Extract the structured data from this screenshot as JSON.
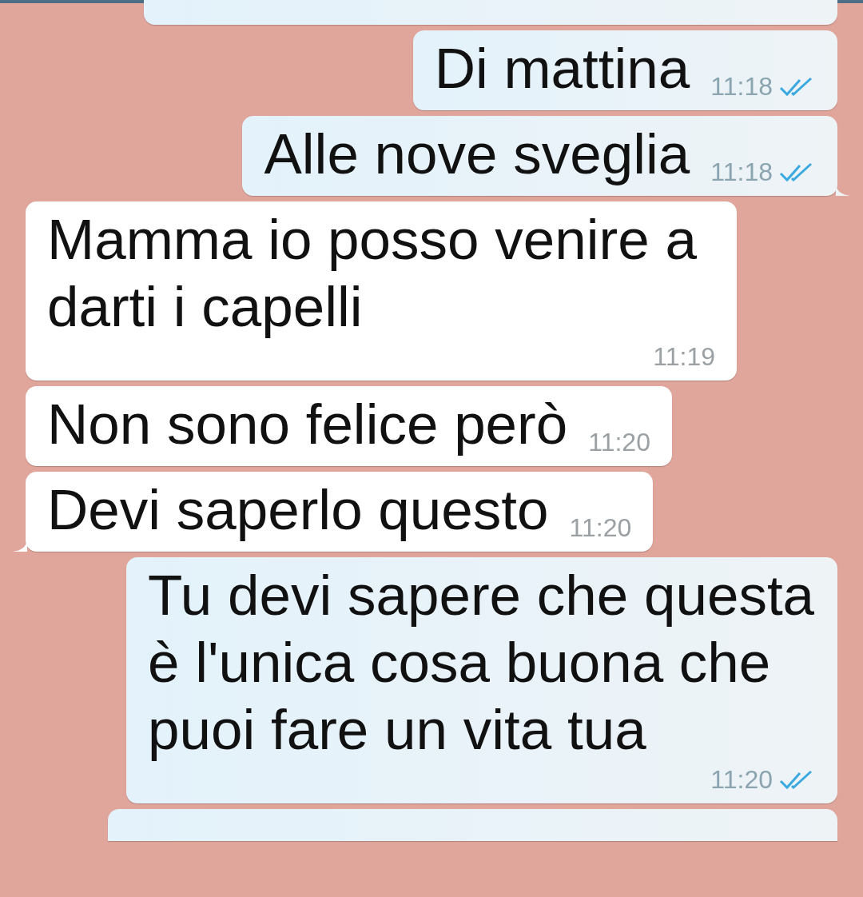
{
  "messages": [
    {
      "kind": "cropped",
      "outgoing": true
    },
    {
      "kind": "text",
      "outgoing": true,
      "text": "Di mattina",
      "time": "11:18",
      "read": true,
      "tail": false
    },
    {
      "kind": "text",
      "outgoing": true,
      "text": "Alle nove sveglia",
      "time": "11:18",
      "read": true,
      "tail": true
    },
    {
      "kind": "text",
      "outgoing": false,
      "text": "Mamma io posso venire a darti i capelli",
      "time": "11:19",
      "tail": false
    },
    {
      "kind": "text",
      "outgoing": false,
      "text": "Non sono felice però",
      "time": "11:20",
      "tail": false
    },
    {
      "kind": "text",
      "outgoing": false,
      "text": "Devi saperlo questo",
      "time": "11:20",
      "tail": true
    },
    {
      "kind": "text",
      "outgoing": true,
      "text": "Tu devi sapere che questa è l'unica cosa buona che puoi fare un vita tua",
      "time": "11:20",
      "read": true,
      "tail": false
    },
    {
      "kind": "cropped",
      "outgoing": true
    }
  ]
}
